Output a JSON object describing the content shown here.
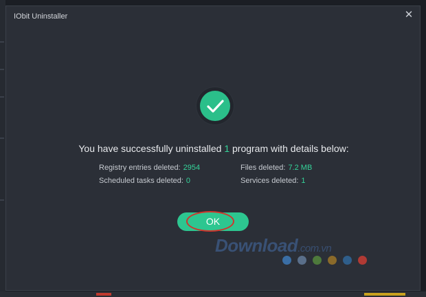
{
  "window": {
    "title": "IObit Uninstaller",
    "close_glyph": "✕"
  },
  "summary": {
    "prefix": "You have successfully uninstalled ",
    "count": "1",
    "suffix": " program with details below:"
  },
  "details": {
    "registry_label": "Registry entries deleted:",
    "registry_value": "2954",
    "files_label": "Files deleted:",
    "files_value": "7.2 MB",
    "tasks_label": "Scheduled tasks deleted:",
    "tasks_value": "0",
    "services_label": "Services deleted:",
    "services_value": "1"
  },
  "ok_button": {
    "label": "OK"
  },
  "watermark": {
    "text": "Download",
    "suffix": ".com.vn"
  },
  "colors": {
    "accent": "#2bbf8a",
    "value_text": "#35d49a",
    "dialog_bg": "#2b2f37",
    "highlight_ring": "#d0342c",
    "dots": [
      "#3a6ea5",
      "#5a6f8a",
      "#4e7a3c",
      "#8a6a2a",
      "#2f5e8a",
      "#b03a34"
    ]
  }
}
